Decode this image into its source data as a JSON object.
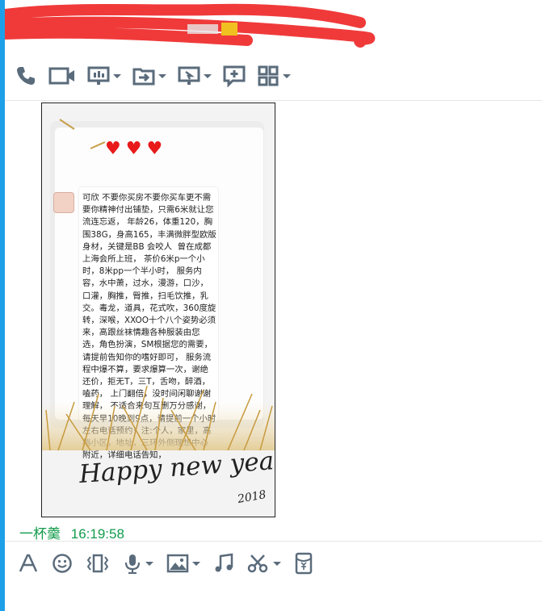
{
  "titlebar": {
    "title_redacted": true
  },
  "top_toolbar": {
    "buttons": [
      {
        "icon": "phone-icon",
        "has_dropdown": false
      },
      {
        "icon": "video-icon",
        "has_dropdown": false
      },
      {
        "icon": "screen-share-icon",
        "has_dropdown": true
      },
      {
        "icon": "file-transfer-icon",
        "has_dropdown": true
      },
      {
        "icon": "remote-desktop-icon",
        "has_dropdown": true
      },
      {
        "icon": "whiteboard-icon",
        "has_dropdown": false
      },
      {
        "icon": "apps-grid-icon",
        "has_dropdown": true
      }
    ],
    "icon_color": "#5a6b7b"
  },
  "message": {
    "image": {
      "hearts": "♥♥♥",
      "bubble_text": "可欣 不要你买房不要你买车更不需要你精神付出铺垫，只需6米就让您流连忘返， 年龄26，体重120，胸围38G，身高165，丰满微胖型欧版身材，关键是BB 会咬人  曾在成都上海会所上班， 茶价6米p一个小时，8米pp一个半小时， 服务内容，水中萧，过水，漫游，口沙，口灌，胸推，臀推，扫毛饮推，乳交。毒龙，道具，花式吹，360度旋转，深喉，XXOO十个八个姿势必须来，高跟丝袜情趣各种服装由您选，角色扮演，SM根据您的需要，请提前告知你的嗜好即可， 服务流程中爆不算，要求爆算一次，谢绝还价，拒无T，三T，舌吻，醉酒，嗑药， 上门翻倍，没时间闲聊谢谢理解， 不适合来句互删万分感谢，每天早10晚到9点，请提前一个小时左右电话预约！注:个人，家里，高档小区，地址，三环外侧理想中心附近，详细电话告知，",
      "greeting": "Happy new year!",
      "year": "2018"
    },
    "sender": "一杯羹",
    "time": "16:19:58",
    "sender_color": "#149c4c"
  },
  "input_toolbar": {
    "buttons": [
      {
        "icon": "font-icon",
        "has_dropdown": false
      },
      {
        "icon": "emoji-icon",
        "has_dropdown": false
      },
      {
        "icon": "shake-window-icon",
        "has_dropdown": false
      },
      {
        "icon": "microphone-icon",
        "has_dropdown": true
      },
      {
        "icon": "image-icon",
        "has_dropdown": true
      },
      {
        "icon": "music-icon",
        "has_dropdown": false
      },
      {
        "icon": "screenshot-scissors-icon",
        "has_dropdown": true
      },
      {
        "icon": "red-packet-icon",
        "has_dropdown": false
      }
    ]
  },
  "colors": {
    "accent": "#1ea0e8",
    "redaction": "#f03a3a"
  }
}
